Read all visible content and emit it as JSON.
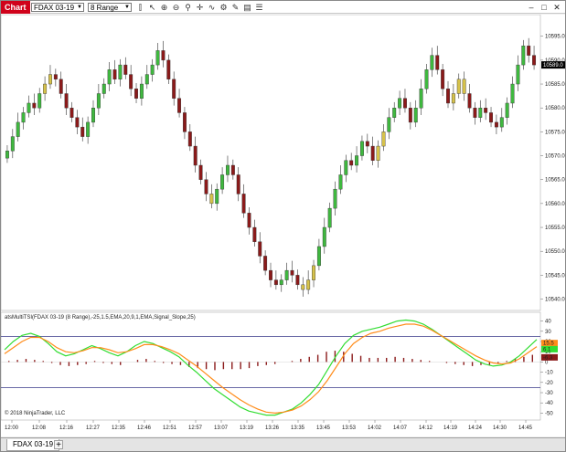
{
  "window": {
    "chart_tab": "Chart",
    "instrument": "FDAX 03-19",
    "period": "8 Range",
    "toolbar_icons": [
      "bar-type-icon",
      "pointer-icon",
      "zoom-in-icon",
      "zoom-out-icon",
      "magnifier-icon",
      "crosshair-icon",
      "indicator-icon",
      "strategy-icon",
      "drawing-icon",
      "properties-icon",
      "list-icon"
    ],
    "buttons": [
      "minimize-icon",
      "maximize-icon",
      "close-icon"
    ]
  },
  "footer": {
    "tab_label": "FDAX 03-19",
    "add_label": "+"
  },
  "chart_data": [
    {
      "type": "candlestick",
      "title": "",
      "ylim": [
        10538,
        10598
      ],
      "y_ticks": [
        10540,
        10545,
        10550,
        10555,
        10560,
        10565,
        10570,
        10575,
        10580,
        10585,
        10590,
        10595
      ],
      "last_price_label": "10589.0",
      "candle_colors": {
        "up": "#3fb83f",
        "down": "#8b1a1a",
        "neutral": "#d6c24a"
      },
      "closes": [
        10571,
        10574,
        10577,
        10579,
        10581,
        10580,
        10583,
        10585,
        10587,
        10586,
        10583,
        10580,
        10578,
        10576,
        10574,
        10577,
        10580,
        10583,
        10585,
        10588,
        10586,
        10589,
        10587,
        10584,
        10582,
        10585,
        10587,
        10589,
        10592,
        10590,
        10586,
        10582,
        10579,
        10575,
        10572,
        10568,
        10565,
        10562,
        10560,
        10563,
        10566,
        10568,
        10566,
        10562,
        10558,
        10555,
        10552,
        10549,
        10546,
        10544,
        10543,
        10544,
        10546,
        10545,
        10543,
        10542,
        10544,
        10547,
        10551,
        10555,
        10559,
        10563,
        10566,
        10569,
        10568,
        10570,
        10573,
        10572,
        10569,
        10572,
        10575,
        10578,
        10580,
        10582,
        10580,
        10577,
        10580,
        10584,
        10588,
        10591,
        10588,
        10584,
        10581,
        10583,
        10586,
        10583,
        10580,
        10578,
        10580,
        10579,
        10577,
        10576,
        10578,
        10581,
        10585,
        10589,
        10593,
        10591,
        10589
      ],
      "neutral_index": [
        7,
        8,
        38,
        55,
        56,
        57,
        69,
        70,
        83,
        84,
        85
      ],
      "x_tick_labels": [
        "12:00",
        "12:08",
        "12:16",
        "12:27",
        "12:35",
        "12:46",
        "12:51",
        "12:57",
        "13:07",
        "13:19",
        "13:26",
        "13:35",
        "13:45",
        "13:53",
        "14:02",
        "14:07",
        "14:12",
        "14:19",
        "14:24",
        "14:30",
        "14:45"
      ]
    },
    {
      "type": "line",
      "title": "atsMultiTSI(FDAX 03-19 (8 Range),-25,1.5,EMA,20,9,1,EMA,Signal_Slope,25)",
      "ylim": [
        -55,
        45
      ],
      "y_ticks": [
        40,
        30,
        20,
        10,
        0,
        -10,
        -20,
        -30,
        -40,
        -50
      ],
      "levels": [
        25,
        -25
      ],
      "value_labels": [
        {
          "text": "15.5",
          "color": "#ff8c1a"
        },
        {
          "text": "6.1",
          "color": "#33dd33"
        },
        {
          "text": "-6.3",
          "color": "#8b1a1a"
        }
      ],
      "series": [
        {
          "values": [
            12,
            20,
            26,
            28,
            25,
            18,
            10,
            6,
            8,
            12,
            16,
            13,
            9,
            6,
            10,
            16,
            20,
            18,
            14,
            10,
            5,
            -3,
            -10,
            -18,
            -26,
            -32,
            -38,
            -44,
            -48,
            -50,
            -52,
            -52,
            -49,
            -46,
            -40,
            -32,
            -22,
            -8,
            6,
            18,
            26,
            30,
            32,
            34,
            37,
            40,
            41,
            40,
            37,
            32,
            26,
            20,
            14,
            8,
            2,
            -2,
            -4,
            -3,
            0,
            6,
            14,
            22
          ]
        },
        {
          "values": [
            8,
            14,
            20,
            24,
            24,
            20,
            14,
            10,
            9,
            11,
            14,
            14,
            12,
            9,
            10,
            13,
            17,
            17,
            15,
            12,
            8,
            2,
            -4,
            -11,
            -18,
            -25,
            -31,
            -37,
            -42,
            -46,
            -49,
            -50,
            -49,
            -47,
            -43,
            -37,
            -29,
            -18,
            -5,
            8,
            18,
            24,
            28,
            30,
            33,
            35,
            37,
            37,
            35,
            31,
            26,
            21,
            16,
            11,
            6,
            2,
            -1,
            -2,
            -1,
            3,
            9,
            15
          ]
        }
      ],
      "histogram": [
        1,
        2,
        3,
        2,
        1,
        -1,
        -3,
        -4,
        -3,
        -2,
        1,
        -1,
        -2,
        -3,
        0,
        2,
        3,
        1,
        -1,
        -2,
        -3,
        -5,
        -6,
        -7,
        -8,
        -7,
        -7,
        -7,
        -6,
        -4,
        -3,
        -2,
        0,
        1,
        3,
        5,
        7,
        10,
        11,
        10,
        8,
        6,
        4,
        4,
        4,
        5,
        4,
        3,
        2,
        1,
        0,
        -1,
        -2,
        -3,
        -4,
        -3,
        -3,
        -1,
        1,
        3,
        5,
        7
      ],
      "copyright": "© 2018 NinjaTrader, LLC"
    }
  ]
}
